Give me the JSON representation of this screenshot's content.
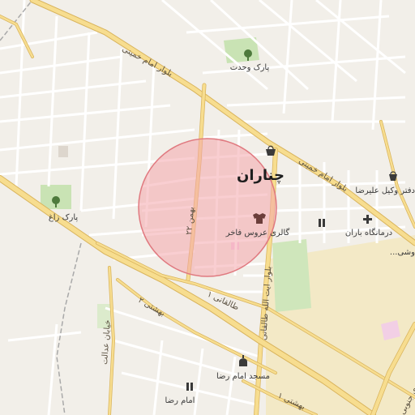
{
  "map": {
    "colors": {
      "background": "#f2efe9",
      "block": "#ece8e1",
      "minor_road": "#ffffff",
      "major_road": "#f7dd8f",
      "major_road_casing": "#d9b45d",
      "railway": "#a9a9a9",
      "park": "#c9e3b4",
      "industrial": "#f3e9c6",
      "circle_fill": "#f4a6ab",
      "circle_stroke": "#e07a80",
      "district_text": "#1e1e1e"
    },
    "district": {
      "label": "چناران"
    },
    "roads": {
      "blvd_imam_khomeini_west": "بلوار امام خمینی",
      "blvd_imam_khomeini_east": "بلوار امام خمینی",
      "street_22_bahman": "۲۲ بهمن",
      "blvd_ayatollah_taleghani": "بلوار ایت الله طالقانی",
      "taleghani_1": "طالقانی ۱",
      "beheshti_2": "بهشتی ۲",
      "beheshti_1": "بهشتی ۱",
      "khiaban_edalat": "خیابان عدالت",
      "blvd_motahari_south": "بلوار مطهری جنوبی"
    },
    "pois": {
      "park_vahdat": {
        "label": "پارک وحدت",
        "icon": "tree-icon"
      },
      "park_zagh": {
        "label": "پارک زاغ",
        "icon": "tree-icon"
      },
      "gallery_aroos_fakher": {
        "label": "گالری عروس فاخر",
        "icon": "shirt-icon"
      },
      "lawyer_alireza": {
        "label": "دفتر وکیل علیرضا",
        "icon": "shop-bag-icon"
      },
      "clinic_baran": {
        "label": "درمانگاه باران",
        "icon": "cross-icon"
      },
      "masjed_imam_reza": {
        "label": "مسجد امام رضا",
        "icon": "mosque-icon"
      },
      "imam_reza": {
        "label": "امام رضا",
        "icon": "school-icon"
      },
      "shop_edge": {
        "label": "...وشی",
        "icon": ""
      }
    }
  }
}
